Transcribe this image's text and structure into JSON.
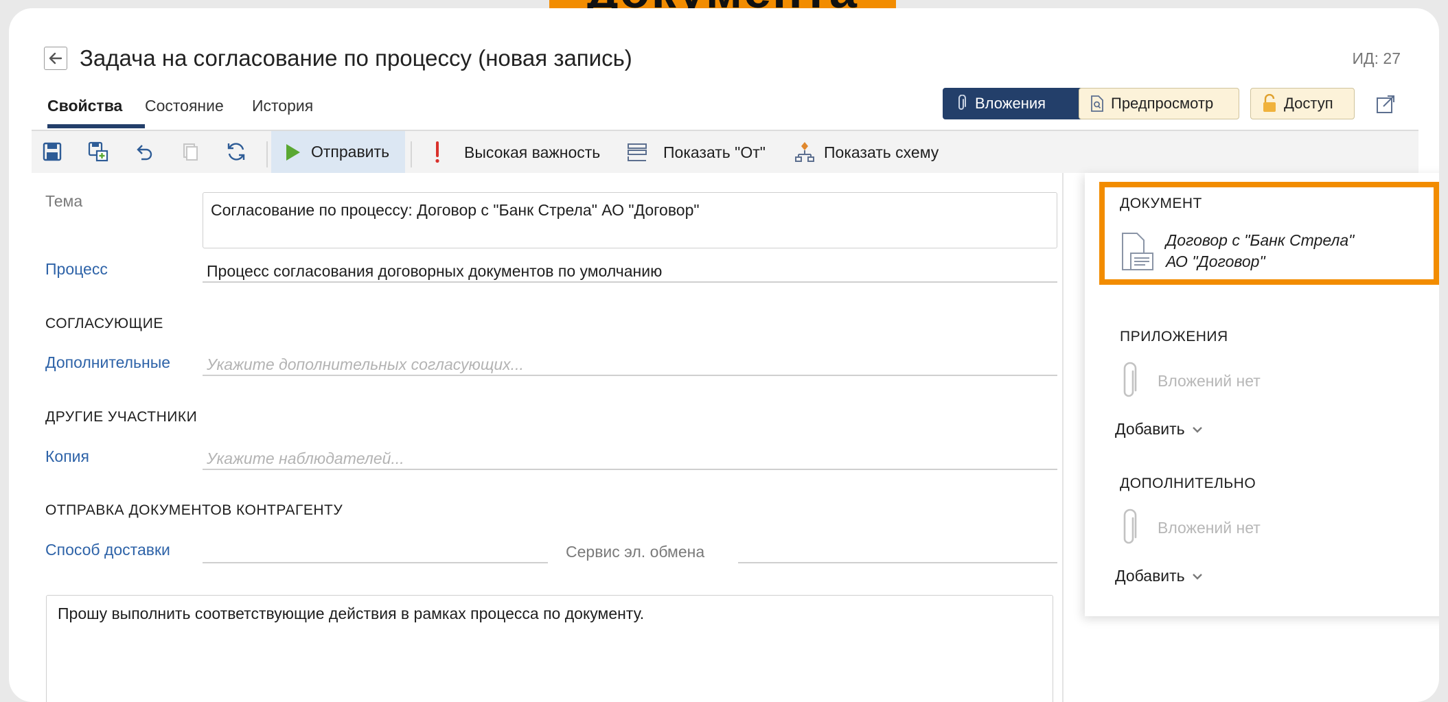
{
  "banner": {
    "text": "документа",
    "color": "#f28c00"
  },
  "header": {
    "title": "Задача на согласование по процессу (новая запись)",
    "record_id": "ИД: 27"
  },
  "tabs": [
    {
      "label": "Свойства",
      "active": true
    },
    {
      "label": "Состояние",
      "active": false
    },
    {
      "label": "История",
      "active": false
    }
  ],
  "actions": {
    "attachments": "Вложения",
    "preview": "Предпросмотр",
    "access": "Доступ"
  },
  "toolbar": {
    "icons": [
      "save-icon",
      "save-and-copy-icon",
      "undo-icon",
      "copy-icon",
      "refresh-icon"
    ],
    "send": "Отправить",
    "importance": "Высокая важность",
    "show_from": "Показать \"От\"",
    "show_scheme": "Показать схему"
  },
  "form": {
    "theme_label": "Тема",
    "theme_value": "Согласование по процессу: Договор с \"Банк Стрела\" АО \"Договор\"",
    "process_label": "Процесс",
    "process_value": "Процесс согласования договорных документов по умолчанию",
    "approvers_section": "СОГЛАСУЮЩИЕ",
    "additional_label": "Дополнительные",
    "additional_placeholder": "Укажите дополнительных согласующих...",
    "participants_section": "ДРУГИЕ УЧАСТНИКИ",
    "copy_label": "Копия",
    "copy_placeholder": "Укажите наблюдателей...",
    "counterparty_section": "ОТПРАВКА ДОКУМЕНТОВ КОНТРАГЕНТУ",
    "delivery_label": "Способ доставки",
    "delivery_value": "",
    "exchange_label": "Сервис эл. обмена",
    "exchange_value": "",
    "comment": "Прошу выполнить соответствующие действия в рамках процесса по документу."
  },
  "side_panel": {
    "document_section": "ДОКУМЕНТ",
    "document_title_line1": "Договор с \"Банк Стрела\"",
    "document_title_line2": "АО \"Договор\"",
    "appendices_section": "ПРИЛОЖЕНИЯ",
    "appendices_empty": "Вложений нет",
    "appendices_add": "Добавить",
    "additional_section": "ДОПОЛНИТЕЛЬНО",
    "additional_empty": "Вложений нет",
    "additional_add": "Добавить"
  },
  "colors": {
    "accent": "#233f6a",
    "link": "#2e63a8",
    "highlight": "#f28c00",
    "send_icon": "#5aa832",
    "importance_icon": "#d9312b"
  }
}
